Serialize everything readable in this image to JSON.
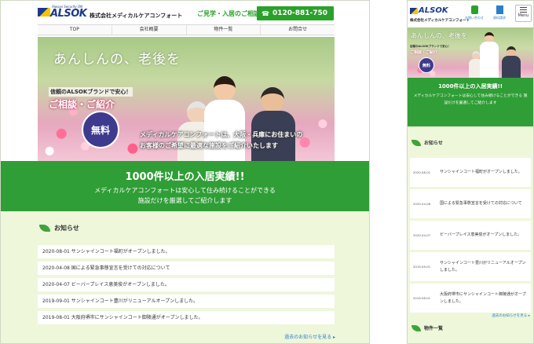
{
  "brand": {
    "tagline": "Always Security ON",
    "logo_text": "ALSOK",
    "company": "株式会社メディカルケアコンフォート",
    "mobile_company": "株式会社メディカルケアコンフォート"
  },
  "header": {
    "consult_label": "ご見学・入居のご相談",
    "phone": "0120-881-750",
    "mobile_phone_label": "お問い合わせ",
    "mobile_doc_label": "資料請求",
    "menu_label": "Menu"
  },
  "nav": {
    "items": [
      {
        "label": "TOP"
      },
      {
        "label": "会社概要"
      },
      {
        "label": "物件一覧"
      },
      {
        "label": "お問合せ"
      }
    ]
  },
  "hero": {
    "title": "あんしんの、老後を",
    "brand_line": "信頼のALSOKブランドで安心！",
    "consult": "ご相談・ご紹介",
    "free_badge": "無料",
    "copy_line1": "メディカルケアコンフォートは、大阪・兵庫にお住まいの",
    "copy_line2": "お客様のご希望に最適な施設をご紹介いたします"
  },
  "banner": {
    "headline": "1000件以上の入居実績!!",
    "sub_line1": "メディカルケアコンフォートは安心して住み続けることができる",
    "sub_line2": "施設だけを厳選してご紹介します"
  },
  "news": {
    "title": "お知らせ",
    "more_label": "過去のお知らせを見る",
    "items": [
      {
        "date": "2020-08-01",
        "text": "サンシャインコート福町がオープンしました。"
      },
      {
        "date": "2020-04-08",
        "text": "国による緊急事態宣言を受けての対応について"
      },
      {
        "date": "2020-04-07",
        "text": "ビーバープレイス恵美俊がオープンしました。"
      },
      {
        "date": "2019-09-01",
        "text": "サンシャインコート豊川がリニューアルオープンしました。"
      },
      {
        "date": "2019-08-01",
        "text": "大阪府堺市にサンシャインコート御陵通がオープンしました。"
      }
    ]
  },
  "mobile": {
    "properties_title": "物件一覧"
  },
  "colors": {
    "primary_green": "#2f9e36",
    "light_green_bg": "#eef7da",
    "brand_navy": "#1a3a8a",
    "badge_purple": "#3e3a8e",
    "link_blue": "#2a7fc9"
  }
}
